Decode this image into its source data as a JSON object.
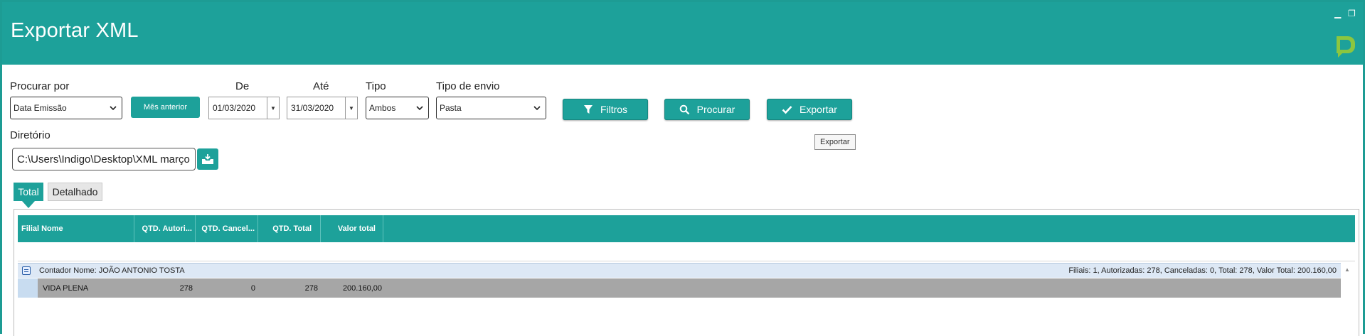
{
  "window": {
    "title": "Exportar XML",
    "minimize_glyph": "▁",
    "restore_glyph": "❐",
    "brand_color": "#1da19a"
  },
  "filters": {
    "search_by_label": "Procurar por",
    "search_by_value": "Data Emissão",
    "prev_month_label": "Mês anterior",
    "from_label": "De",
    "from_value": "01/03/2020",
    "to_label": "Até",
    "to_value": "31/03/2020",
    "type_label": "Tipo",
    "type_value": "Ambos",
    "send_type_label": "Tipo de envio",
    "send_type_value": "Pasta",
    "filters_button": "Filtros",
    "search_button": "Procurar",
    "export_button": "Exportar",
    "export_tooltip": "Exportar"
  },
  "directory": {
    "label": "Diretório",
    "value": "C:\\Users\\Indigo\\Desktop\\XML março"
  },
  "tabs": [
    {
      "label": "Total",
      "active": true
    },
    {
      "label": "Detalhado",
      "active": false
    }
  ],
  "grid": {
    "columns": [
      "Filial Nome",
      "QTD. Autori...",
      "QTD. Cancel...",
      "QTD. Total",
      "Valor total"
    ],
    "group": {
      "label": "Contador Nome: JOÃO ANTONIO TOSTA",
      "summary": "Filiais: 1,   Autorizadas: 278,   Canceladas: 0,   Total: 278,   Valor Total: 200.160,00"
    },
    "rows": [
      {
        "filial": "VIDA PLENA",
        "autorizadas": "278",
        "canceladas": "0",
        "total": "278",
        "valor": "200.160,00"
      }
    ]
  }
}
